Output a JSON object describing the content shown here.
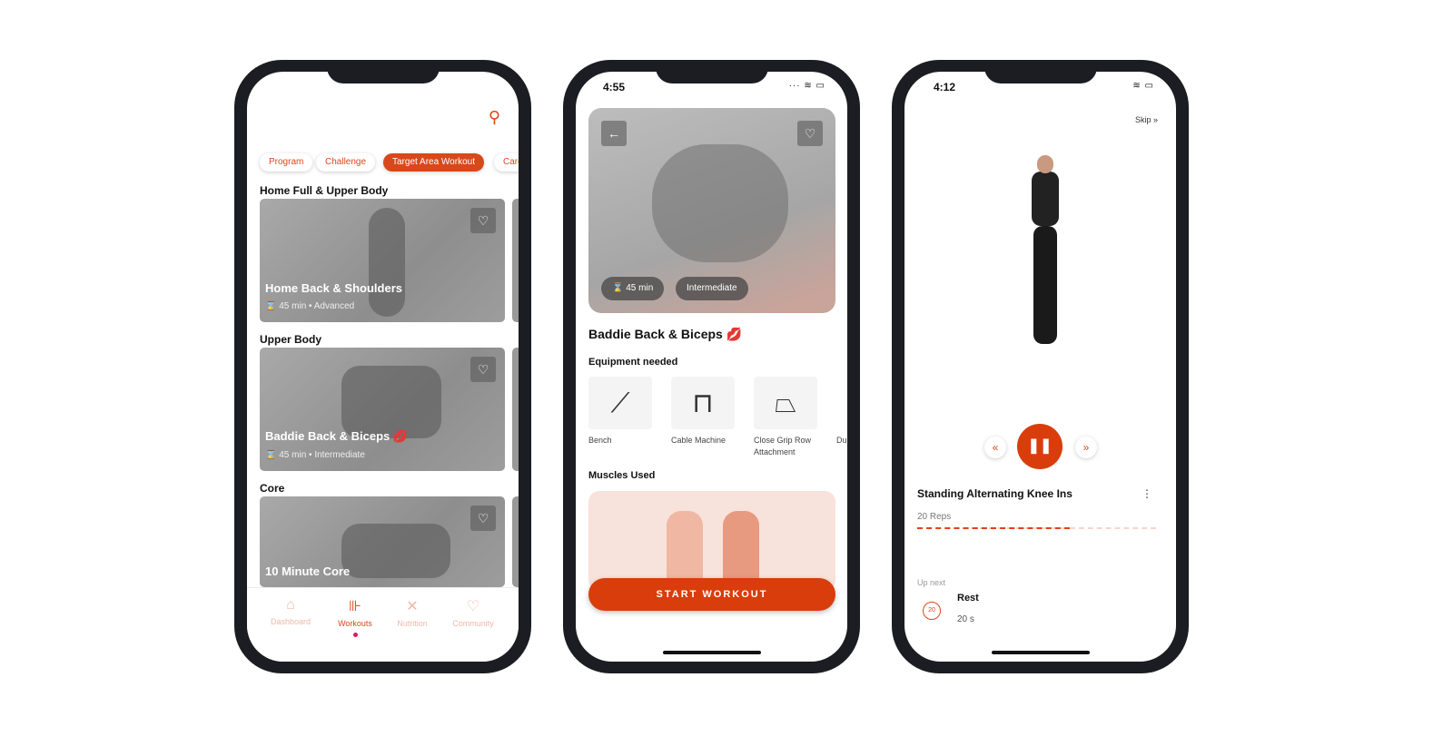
{
  "colors": {
    "accent": "#d9481a",
    "frame": "#1b1d22"
  },
  "screen1": {
    "search_icon": "search-icon",
    "chips": [
      "Program",
      "Challenge",
      "Target Area Workout",
      "Cardio"
    ],
    "active_chip": "Target Area Workout",
    "sections": [
      {
        "title": "Home Full & Upper Body",
        "card": {
          "title": "Home Back & Shoulders",
          "duration": "45 min",
          "level": "Advanced"
        }
      },
      {
        "title": "Upper Body",
        "card": {
          "title": "Baddie Back & Biceps",
          "emoji": "💋",
          "duration": "45 min",
          "level": "Intermediate"
        }
      },
      {
        "title": "Core",
        "card": {
          "title": "10 Minute Core"
        }
      }
    ],
    "nav": [
      {
        "label": "Dashboard",
        "icon": "home-icon"
      },
      {
        "label": "Workouts",
        "icon": "dumbbell-icon",
        "active": true
      },
      {
        "label": "Nutrition",
        "icon": "utensils-icon"
      },
      {
        "label": "Community",
        "icon": "heart-hands-icon"
      }
    ]
  },
  "screen2": {
    "time": "4:55",
    "duration": "45  min",
    "level": "Intermediate",
    "title": "Baddie Back & Biceps",
    "emoji": "💋",
    "equipment_heading": "Equipment needed",
    "equipment": [
      "Bench",
      "Cable Machine",
      "Close Grip Row Attachment",
      "Du"
    ],
    "muscles_heading": "Muscles Used",
    "start_button": "START WORKOUT"
  },
  "screen3": {
    "time": "4:12",
    "skip": "Skip",
    "exercise": "Standing Alternating Knee Ins",
    "reps": "20 Reps",
    "progress_percent": 64,
    "up_next_label": "Up next",
    "next_title": "Rest",
    "next_badge": "20",
    "next_duration": "20 s"
  }
}
